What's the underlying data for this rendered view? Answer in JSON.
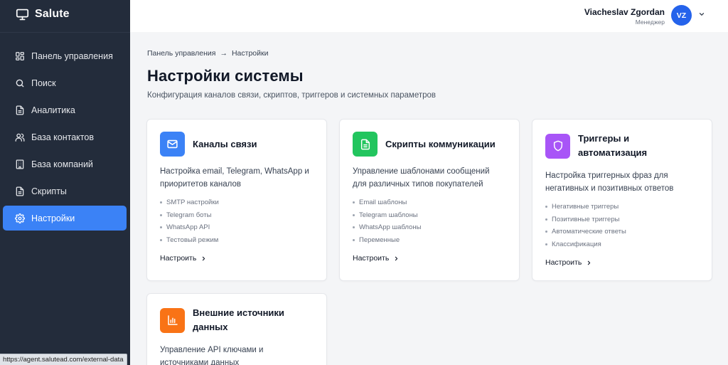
{
  "app": {
    "name": "Salute",
    "logo_icon": "monitor-icon"
  },
  "sidebar": {
    "items": [
      {
        "label": "Панель управления",
        "icon": "dashboard-grid-icon",
        "active": false
      },
      {
        "label": "Поиск",
        "icon": "search-icon",
        "active": false
      },
      {
        "label": "Аналитика",
        "icon": "document-icon",
        "active": false
      },
      {
        "label": "База контактов",
        "icon": "users-icon",
        "active": false
      },
      {
        "label": "База компаний",
        "icon": "building-icon",
        "active": false
      },
      {
        "label": "Скрипты",
        "icon": "document-icon",
        "active": false
      },
      {
        "label": "Настройки",
        "icon": "gear-icon",
        "active": true
      }
    ]
  },
  "header": {
    "user_name": "Viacheslav Zgordan",
    "user_role": "Менеджер",
    "avatar_initials": "VZ"
  },
  "breadcrumb": {
    "parent": "Панель управления",
    "separator": "→",
    "current": "Настройки"
  },
  "page": {
    "title": "Настройки системы",
    "subtitle": "Конфигурация каналов связи, скриптов, триггеров и системных параметров"
  },
  "cards": [
    {
      "title": "Каналы связи",
      "icon": "mail-icon",
      "color": "#3b82f6",
      "desc_line1": "Настройка email, Telegram, WhatsApp и",
      "desc_line2": "приоритетов каналов",
      "features": [
        "SMTP настройки",
        "Telegram боты",
        "WhatsApp API",
        "Тестовый режим"
      ],
      "action": "Настроить"
    },
    {
      "title": "Скрипты коммуникации",
      "icon": "file-text-icon",
      "color": "#22c55e",
      "desc_line1": "Управление шаблонами сообщений",
      "desc_line2": "для различных типов покупателей",
      "features": [
        "Email шаблоны",
        "Telegram шаблоны",
        "WhatsApp шаблоны",
        "Переменные"
      ],
      "action": "Настроить"
    },
    {
      "title_line1": "Триггеры и",
      "title_line2": "автоматизация",
      "icon": "shield-icon",
      "color": "#a855f7",
      "desc_line1": "Настройка триггерных фраз для",
      "desc_line2": "негативных и позитивных ответов",
      "features": [
        "Негативные триггеры",
        "Позитивные триггеры",
        "Автоматические ответы",
        "Классификация"
      ],
      "action": "Настроить"
    },
    {
      "title_line1": "Внешние источники",
      "title_line2": "данных",
      "icon": "bar-chart-icon",
      "color": "#f97316",
      "desc_line1": "Управление API ключами и",
      "desc_line2": "источниками данных"
    }
  ],
  "status_bar": {
    "url": "https://agent.salutead.com/external-data"
  }
}
